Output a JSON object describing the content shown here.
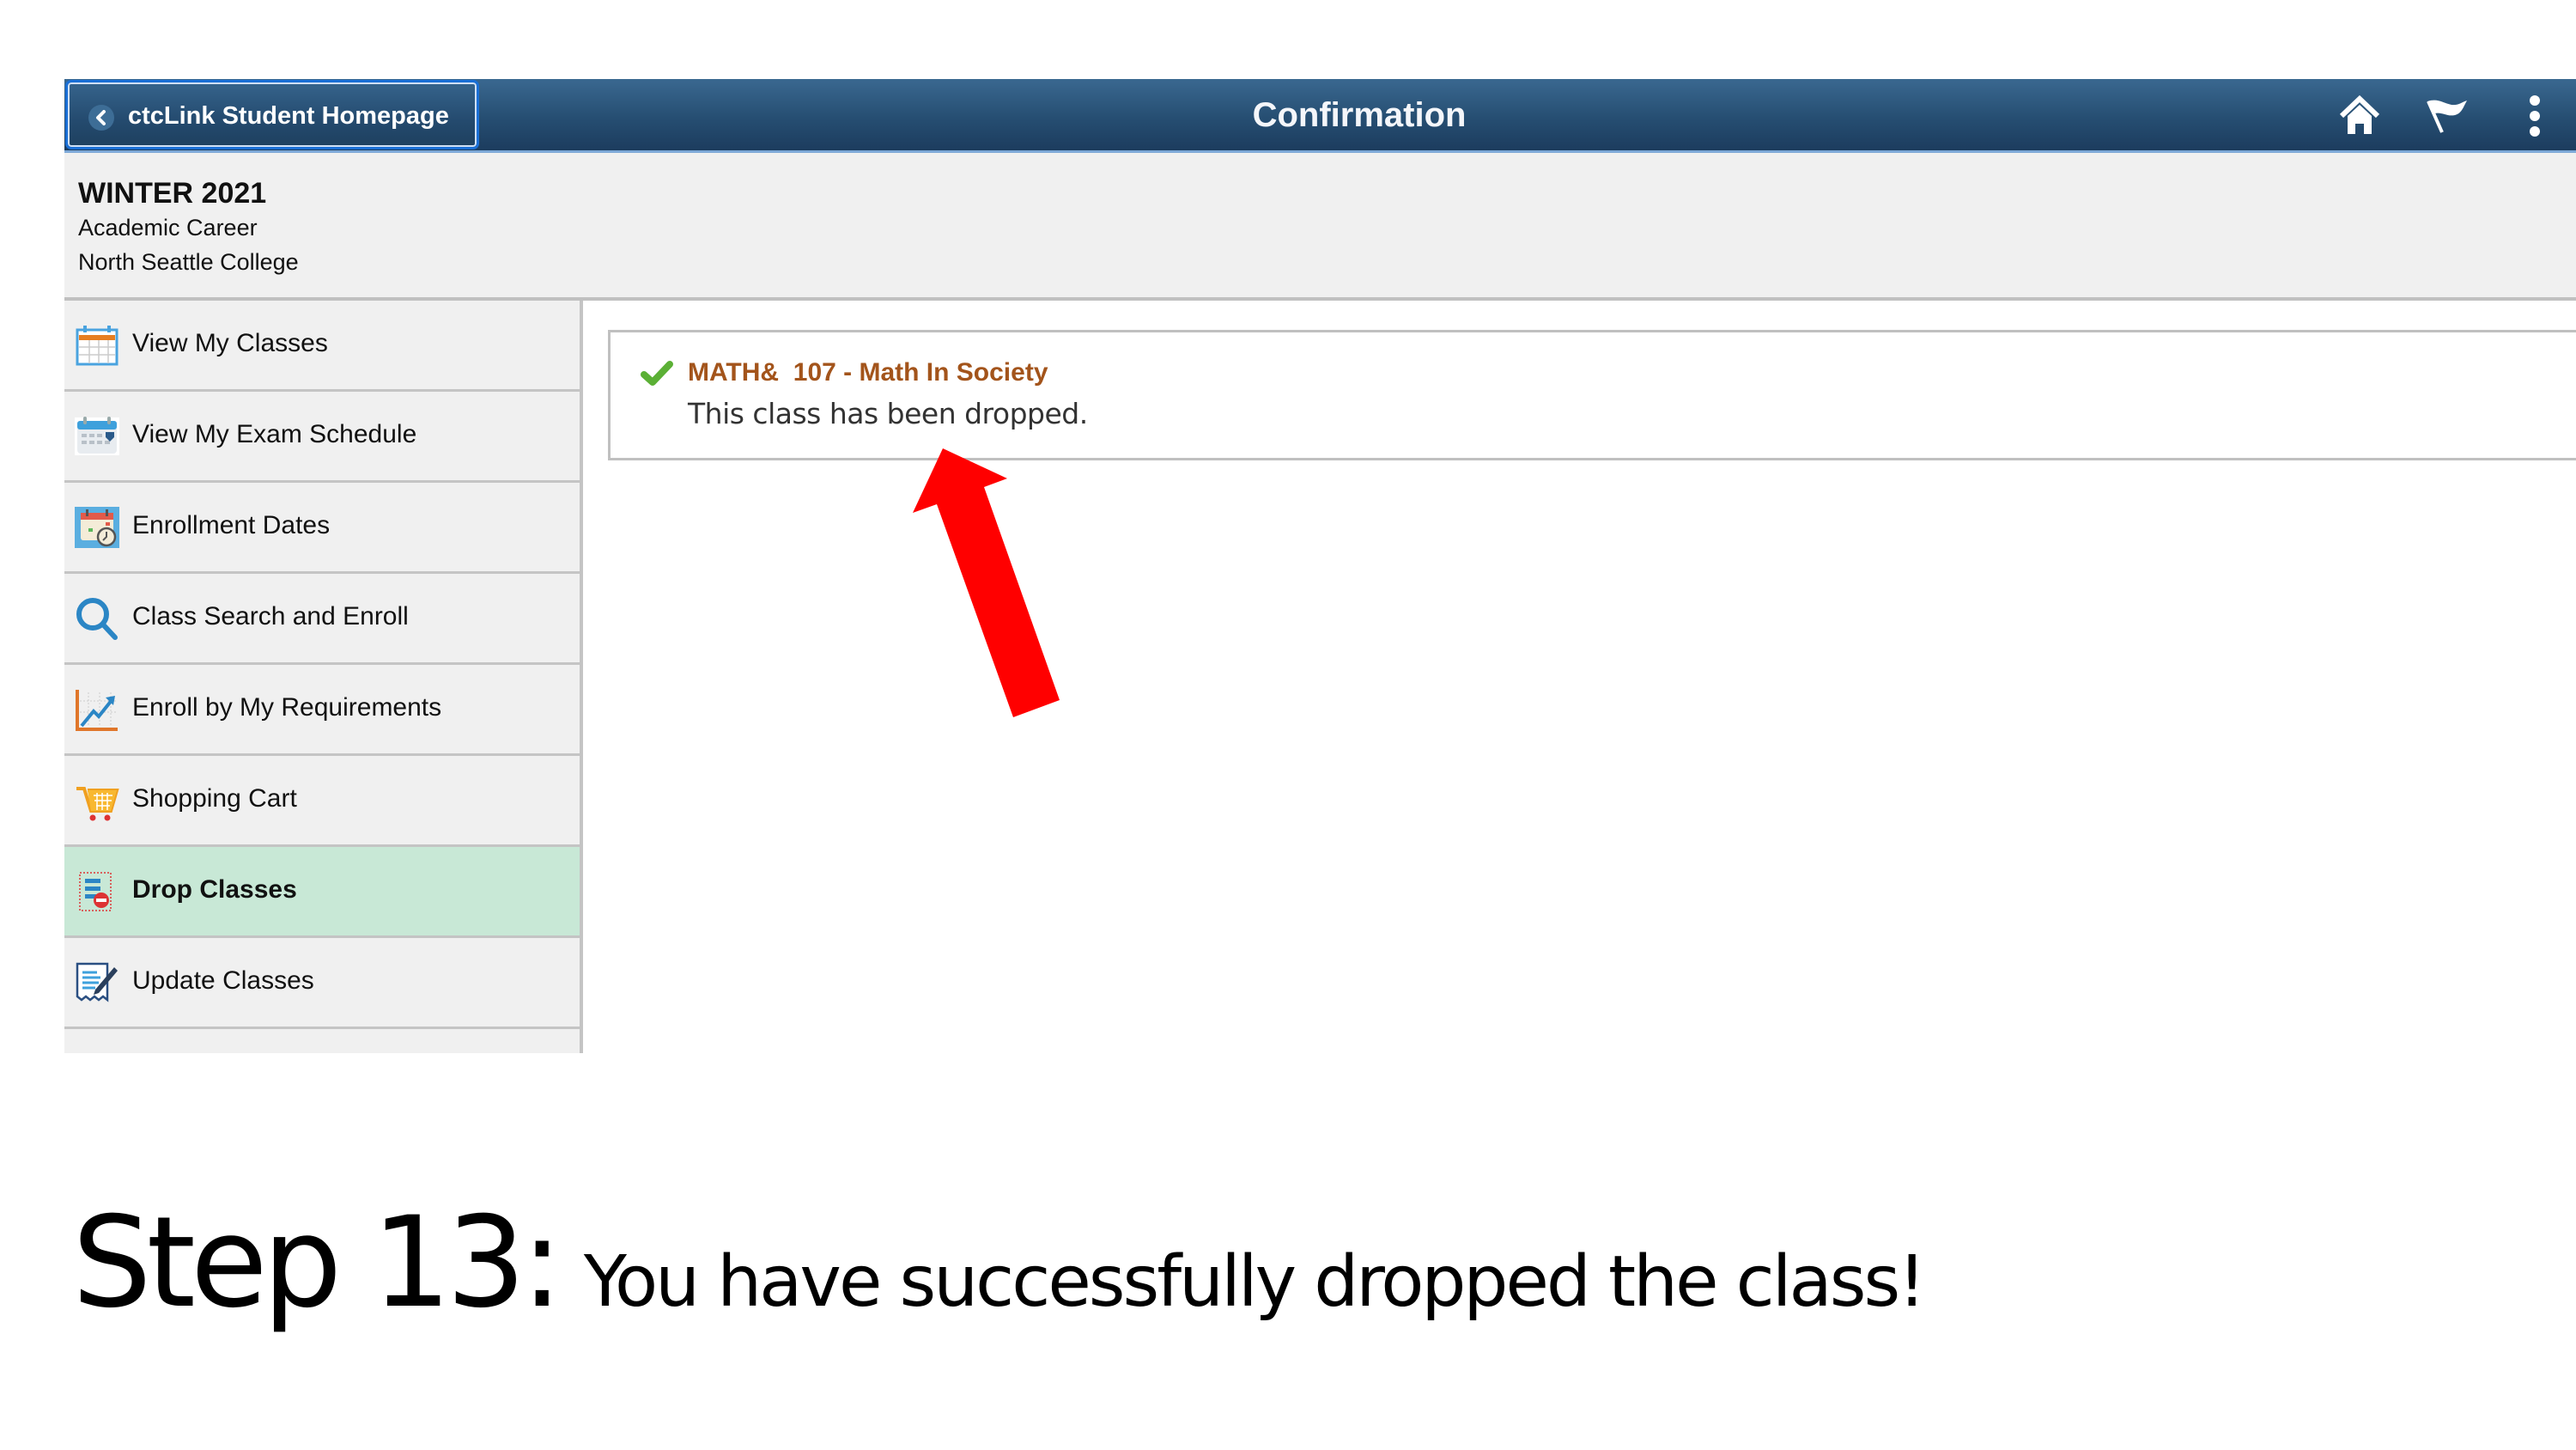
{
  "header": {
    "back_label": "ctcLink Student Homepage",
    "title": "Confirmation",
    "icons": [
      "home-icon",
      "flag-icon",
      "more-options-icon"
    ]
  },
  "context": {
    "term": "WINTER 2021",
    "career": "Academic Career",
    "institution": "North Seattle College"
  },
  "sidebar": {
    "items": [
      {
        "label": "View My Classes",
        "icon": "calendar-icon",
        "active": false
      },
      {
        "label": "View My Exam Schedule",
        "icon": "exam-calendar-icon",
        "active": false
      },
      {
        "label": "Enrollment Dates",
        "icon": "calendar-clock-icon",
        "active": false
      },
      {
        "label": "Class Search and Enroll",
        "icon": "search-icon",
        "active": false
      },
      {
        "label": "Enroll by My Requirements",
        "icon": "chart-trend-icon",
        "active": false
      },
      {
        "label": "Shopping Cart",
        "icon": "cart-icon",
        "active": false
      },
      {
        "label": "Drop Classes",
        "icon": "drop-list-icon",
        "active": true
      },
      {
        "label": "Update Classes",
        "icon": "edit-document-icon",
        "active": false
      }
    ]
  },
  "main": {
    "result": {
      "status_icon": "checkmark-icon",
      "course": "MATH&  107 - Math In Society",
      "message": "This class has been dropped."
    }
  },
  "annotation": {
    "arrow_color": "#ff0000",
    "step": "Step 13:",
    "text": "You have successfully dropped the class!"
  },
  "colors": {
    "header": "#264e72",
    "active_nav": "#c8e8d6",
    "course_title": "#a3541b",
    "check": "#5bb035"
  }
}
